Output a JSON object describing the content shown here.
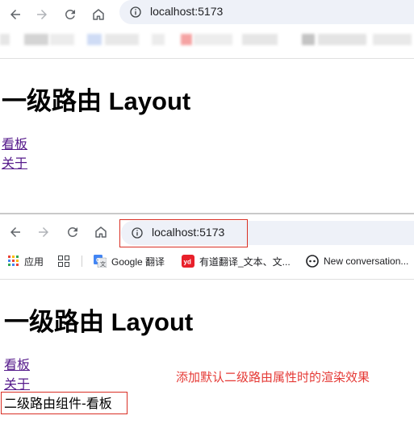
{
  "screens": [
    {
      "address": {
        "url": "localhost:5173"
      },
      "page": {
        "title": "一级路由 Layout",
        "links": [
          {
            "label": "看板"
          },
          {
            "label": "关于"
          }
        ]
      }
    },
    {
      "address": {
        "url": "localhost:5173"
      },
      "bookmarks": [
        {
          "label": "应用",
          "icon": "apps-grid-icon"
        },
        {
          "label": "",
          "icon": "tab-grid-icon"
        },
        {
          "label": "Google 翻译",
          "icon": "google-translate-icon"
        },
        {
          "label": "有道翻译_文本、文...",
          "icon": "youdao-icon"
        },
        {
          "label": "New conversation...",
          "icon": "conversation-icon"
        }
      ],
      "page": {
        "title": "一级路由 Layout",
        "links": [
          {
            "label": "看板"
          },
          {
            "label": "关于"
          }
        ],
        "child_content": "二级路由组件-看板"
      },
      "annotation": "添加默认二级路由属性时的渲染效果"
    }
  ],
  "colors": {
    "annotation": "#e53935",
    "highlight_box": "#d93025",
    "link_visited": "#551a8b",
    "omnibox_bg": "#eef1f8"
  }
}
